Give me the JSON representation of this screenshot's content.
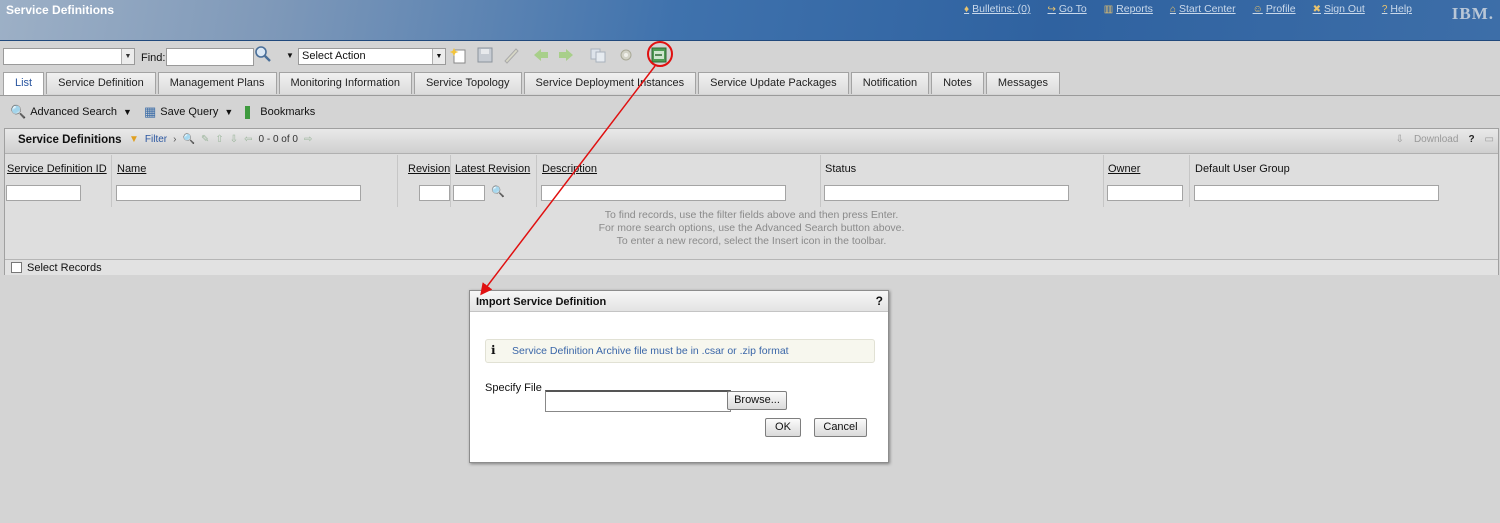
{
  "app": {
    "title": "Service Definitions",
    "logo": "IBM."
  },
  "top_links": [
    {
      "icon": "bulletin-icon",
      "glyph": "♦",
      "label": "Bulletins: (0)"
    },
    {
      "icon": "goto-icon",
      "glyph": "↪",
      "label": "Go To"
    },
    {
      "icon": "reports-icon",
      "glyph": "▥",
      "label": "Reports"
    },
    {
      "icon": "start-center-icon",
      "glyph": "⌂",
      "label": "Start Center"
    },
    {
      "icon": "profile-icon",
      "glyph": "☺",
      "label": "Profile"
    },
    {
      "icon": "signout-icon",
      "glyph": "✖",
      "label": "Sign Out"
    },
    {
      "icon": "help-icon",
      "glyph": "?",
      "label": "Help"
    }
  ],
  "toolbar": {
    "find_label": "Find:",
    "find_value": "",
    "select_action": "Select Action"
  },
  "tabs": [
    {
      "label": "List",
      "active": true
    },
    {
      "label": "Service Definition"
    },
    {
      "label": "Management Plans"
    },
    {
      "label": "Monitoring Information"
    },
    {
      "label": "Service Topology"
    },
    {
      "label": "Service Deployment Instances"
    },
    {
      "label": "Service Update Packages"
    },
    {
      "label": "Notification"
    },
    {
      "label": "Notes"
    },
    {
      "label": "Messages"
    }
  ],
  "query": {
    "advanced_search": "Advanced Search",
    "save_query": "Save Query",
    "bookmarks": "Bookmarks"
  },
  "results": {
    "title": "Service Definitions",
    "filter_label": "Filter",
    "paging": "0 - 0 of 0",
    "download": "Download",
    "columns": [
      {
        "label": "Service Definition ID"
      },
      {
        "label": "Name"
      },
      {
        "label": "Revision"
      },
      {
        "label": "Latest Revision"
      },
      {
        "label": "Description"
      },
      {
        "label": "Status"
      },
      {
        "label": "Owner"
      },
      {
        "label": "Default User Group"
      }
    ],
    "messages": [
      "To find records, use the filter fields above and then press Enter.",
      "For more search options, use the Advanced Search button above.",
      "To enter a new record, select the Insert icon in the toolbar."
    ],
    "select_records": "Select Records"
  },
  "dialog": {
    "title": "Import Service Definition",
    "help": "?",
    "info": "Service Definition Archive file must be in .csar or .zip format",
    "specify_file_label": "Specify File",
    "file_value": "",
    "browse": "Browse...",
    "ok": "OK",
    "cancel": "Cancel"
  },
  "colors": {
    "title_bar": "#2f62a0",
    "annotation": "#e01010",
    "link_text": "#3a66a8"
  }
}
